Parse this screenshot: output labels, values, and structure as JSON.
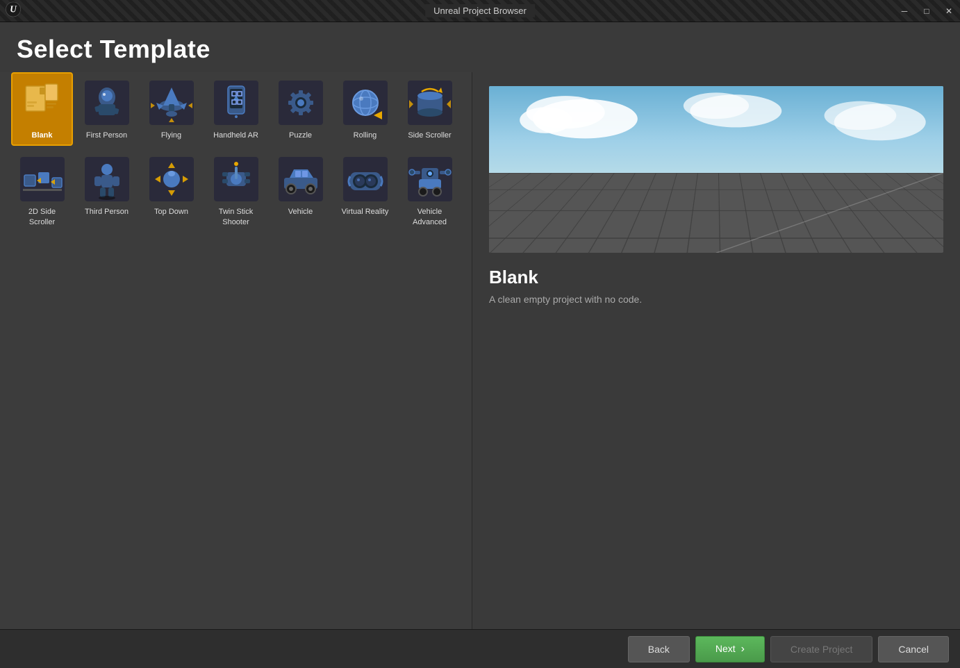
{
  "window": {
    "title": "Unreal Project Browser",
    "controls": {
      "minimize": "─",
      "maximize": "□",
      "close": "✕"
    }
  },
  "page": {
    "title": "Select Template"
  },
  "templates": [
    {
      "id": "blank",
      "label": "Blank",
      "selected": true,
      "row": 0
    },
    {
      "id": "first-person",
      "label": "First Person",
      "selected": false,
      "row": 0
    },
    {
      "id": "flying",
      "label": "Flying",
      "selected": false,
      "row": 0
    },
    {
      "id": "handheld-ar",
      "label": "Handheld AR",
      "selected": false,
      "row": 0
    },
    {
      "id": "puzzle",
      "label": "Puzzle",
      "selected": false,
      "row": 0
    },
    {
      "id": "rolling",
      "label": "Rolling",
      "selected": false,
      "row": 0
    },
    {
      "id": "side-scroller",
      "label": "Side Scroller",
      "selected": false,
      "row": 0
    },
    {
      "id": "2d-side-scroller",
      "label": "2D Side Scroller",
      "selected": false,
      "row": 1
    },
    {
      "id": "third-person",
      "label": "Third Person",
      "selected": false,
      "row": 1
    },
    {
      "id": "top-down",
      "label": "Top Down",
      "selected": false,
      "row": 1
    },
    {
      "id": "twin-stick-shooter",
      "label": "Twin Stick Shooter",
      "selected": false,
      "row": 1
    },
    {
      "id": "vehicle",
      "label": "Vehicle",
      "selected": false,
      "row": 1
    },
    {
      "id": "virtual-reality",
      "label": "Virtual Reality",
      "selected": false,
      "row": 1
    },
    {
      "id": "vehicle-advanced",
      "label": "Vehicle Advanced",
      "selected": false,
      "row": 1
    }
  ],
  "preview": {
    "name": "Blank",
    "description": "A clean empty project with no code."
  },
  "buttons": {
    "back": "Back",
    "next": "Next",
    "next_arrow": "›",
    "create_project": "Create Project",
    "cancel": "Cancel"
  }
}
